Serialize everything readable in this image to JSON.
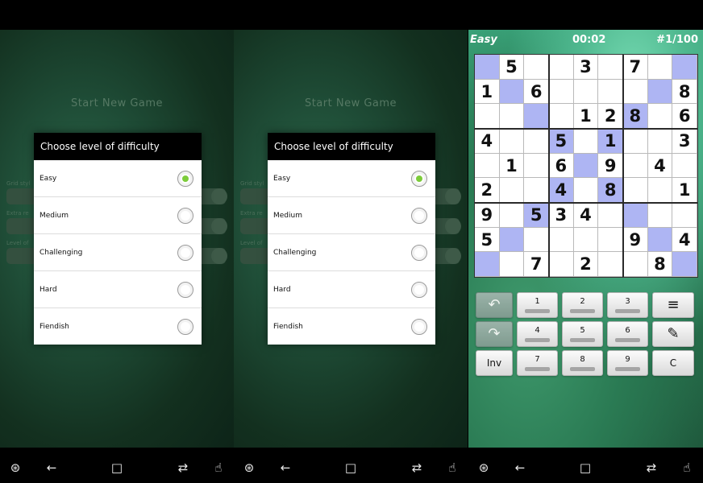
{
  "new_game": {
    "title": "Start New Game",
    "setting_labels": [
      "Grid styl",
      "Extra re",
      "Level of"
    ]
  },
  "difficulty_dialog": {
    "title": "Choose level of difficulty",
    "options": [
      {
        "label": "Easy",
        "selected": true
      },
      {
        "label": "Medium",
        "selected": false
      },
      {
        "label": "Challenging",
        "selected": false
      },
      {
        "label": "Hard",
        "selected": false
      },
      {
        "label": "Fiendish",
        "selected": false
      }
    ]
  },
  "game": {
    "level": "Easy",
    "time": "00:02",
    "puzzle": "#1/100",
    "board": [
      [
        "",
        "5",
        "",
        "",
        "3",
        "",
        "7",
        "",
        ""
      ],
      [
        "1",
        "",
        "6",
        "",
        "",
        "",
        "",
        "",
        "8"
      ],
      [
        "",
        "",
        "",
        "",
        "1",
        "2",
        "8",
        "",
        "6"
      ],
      [
        "4",
        "",
        "",
        "5",
        "",
        "1",
        "",
        "",
        "3"
      ],
      [
        "",
        "1",
        "",
        "6",
        "",
        "9",
        "",
        "4",
        ""
      ],
      [
        "2",
        "",
        "",
        "4",
        "",
        "8",
        "",
        "",
        "1"
      ],
      [
        "9",
        "",
        "5",
        "3",
        "4",
        "",
        "",
        "",
        ""
      ],
      [
        "5",
        "",
        "",
        "",
        "",
        "",
        "9",
        "",
        "4"
      ],
      [
        "",
        "",
        "7",
        "",
        "2",
        "",
        "",
        "8",
        ""
      ]
    ],
    "highlighted": [
      [
        0,
        0
      ],
      [
        0,
        8
      ],
      [
        1,
        1
      ],
      [
        1,
        7
      ],
      [
        2,
        2
      ],
      [
        2,
        6
      ],
      [
        3,
        3
      ],
      [
        3,
        5
      ],
      [
        4,
        4
      ],
      [
        5,
        3
      ],
      [
        5,
        5
      ],
      [
        6,
        2
      ],
      [
        6,
        6
      ],
      [
        7,
        1
      ],
      [
        7,
        7
      ],
      [
        8,
        0
      ],
      [
        8,
        8
      ]
    ],
    "keypad": {
      "digits": [
        "1",
        "2",
        "3",
        "4",
        "5",
        "6",
        "7",
        "8",
        "9"
      ],
      "inv_label": "Inv",
      "clear_label": "C",
      "undo_icon": "undo-icon",
      "redo_icon": "redo-icon",
      "menu_icon": "menu-icon",
      "pencil_icon": "pencil-icon"
    }
  },
  "nav_icons": [
    "accessibility-icon",
    "back-icon",
    "home-icon",
    "recents-icon",
    "gesture-icon"
  ]
}
